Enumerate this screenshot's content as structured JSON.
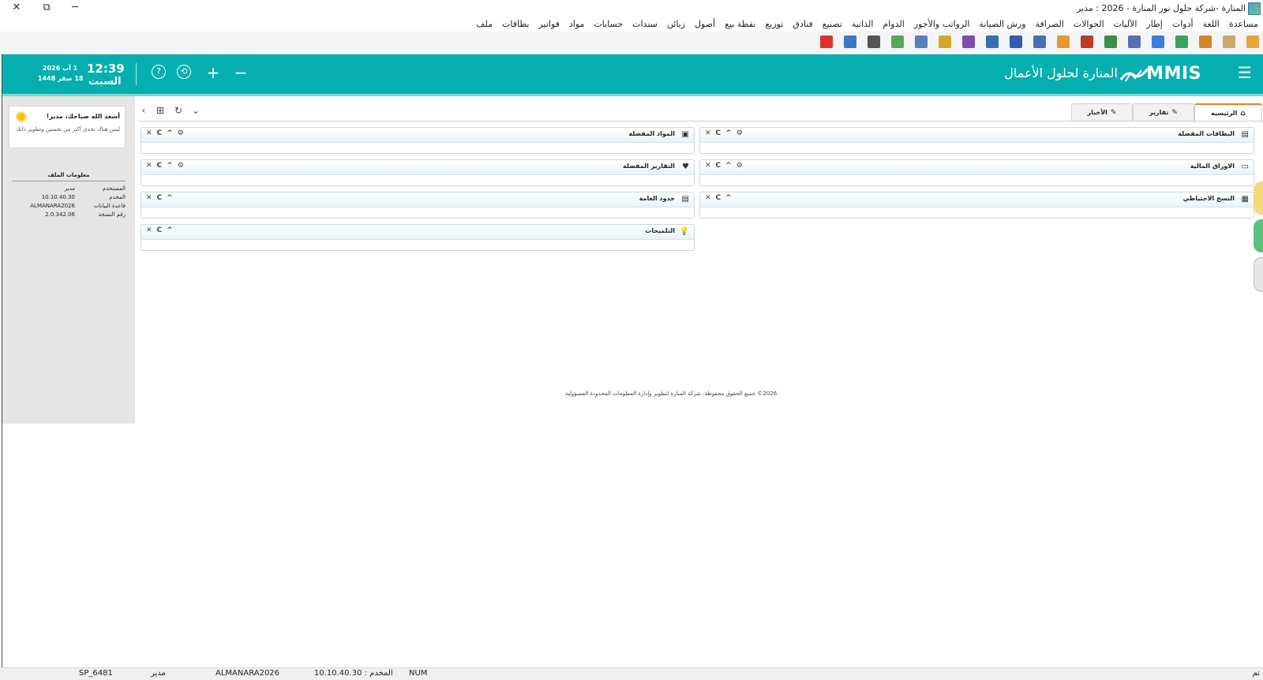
{
  "window": {
    "title": "المنارة -شركة حلول نور المنارة - 2026 : مدير",
    "close_glyph": "✕",
    "restore_glyph": "⧉",
    "minimize_glyph": "─"
  },
  "menu": [
    "ملف",
    "بطاقات",
    "فواتير",
    "مواد",
    "حسابات",
    "سندات",
    "زبائن",
    "أصول",
    "نقطة بيع",
    "توزيع",
    "فنادق",
    "تصنيع",
    "الذاتية",
    "الدوام",
    "الرواتب والأجور",
    "ورش الصيانة",
    "الصرافة",
    "الحوالات",
    "الآليات",
    "إطار",
    "أدوات",
    "اللغة",
    "مساعدة"
  ],
  "toolbar_icons": [
    {
      "name": "folder-icon",
      "color": "#e8a33b"
    },
    {
      "name": "list-card-icon",
      "color": "#c9a86a"
    },
    {
      "name": "users-icon",
      "color": "#d9822b"
    },
    {
      "name": "box-icon",
      "color": "#3aa35c"
    },
    {
      "name": "register-icon",
      "color": "#3b7dd8"
    },
    {
      "name": "document-edit-icon",
      "color": "#5a6fb0"
    },
    {
      "name": "ledger-icon",
      "color": "#3a8f4a"
    },
    {
      "name": "cube-icon",
      "color": "#c0392b"
    },
    {
      "name": "report-icon",
      "color": "#e39b2f"
    },
    {
      "name": "doc-icon",
      "color": "#4a6fb5"
    },
    {
      "name": "book-icon",
      "color": "#2f5fae"
    },
    {
      "name": "balance-icon",
      "color": "#3b6db3"
    },
    {
      "name": "stack-icon",
      "color": "#7b4fb1"
    },
    {
      "name": "money-icon",
      "color": "#d4a62a"
    },
    {
      "name": "person-card-icon",
      "color": "#5b7fb8"
    },
    {
      "name": "palette-icon",
      "color": "#58a65c"
    },
    {
      "name": "barcode-icon",
      "color": "#555555"
    },
    {
      "name": "calculator-icon",
      "color": "#3b78c3"
    },
    {
      "name": "power-icon",
      "color": "#d9342b"
    }
  ],
  "header": {
    "menu_glyph": "☰",
    "logo": "MMIS",
    "brand": "المنارة لحلول الأعمال",
    "help_glyph": "?",
    "sync_glyph": "⟲",
    "add_glyph": "+",
    "minus_glyph": "−",
    "time": "12:39",
    "day": "السبت",
    "gregorian_date": "1 آب 2026",
    "hijri_date": "18 صفر 1448"
  },
  "tabs": [
    {
      "label": "الرئيسيه",
      "icon": "⌂"
    },
    {
      "label": "تقارير",
      "icon": "✎"
    },
    {
      "label": "الأخبار",
      "icon": "✎"
    }
  ],
  "tab_controls": {
    "back": "‹",
    "grid": "⊞",
    "refresh": "↻",
    "expand": "⌄"
  },
  "widget_controls": {
    "close": "✕",
    "refresh": "C",
    "collapse": "^",
    "settings": "⚙"
  },
  "widgets_right": [
    {
      "title": "البطاقات المفضلة",
      "icon": "▤",
      "settings": true
    },
    {
      "title": "الاوراق المالية",
      "icon": "▭",
      "settings": true
    },
    {
      "title": "النسخ الاحتياطي",
      "icon": "▦",
      "settings": false
    }
  ],
  "widgets_left": [
    {
      "title": "المواد المفضلة",
      "icon": "▣",
      "settings": true
    },
    {
      "title": "التقارير المفضلة",
      "icon": "♥",
      "settings": true
    },
    {
      "title": "حدود العامة",
      "icon": "▤",
      "settings": false
    },
    {
      "title": "التلميحات",
      "icon": "💡",
      "settings": false
    }
  ],
  "greeting": {
    "title": "أسعد الله صباحك، مدير!",
    "message": "ليس هناك تحدي أكبر من تحسين وتطوير ذاتك"
  },
  "file_info": {
    "title": "معلومات الملف",
    "rows": [
      {
        "key": "المستخدم",
        "value": "مدير"
      },
      {
        "key": "المخدم",
        "value": "10.10.40.30"
      },
      {
        "key": "قاعدة البيانات",
        "value": "ALMANARA2026"
      },
      {
        "key": "رقم النسخة",
        "value": "2.0.342.06"
      }
    ]
  },
  "copyright": "2026© جميع الحقوق محفوظة، شركة المنارة لتطوير وإدارة المعلومات المحدودة المسؤولية",
  "status": {
    "right_text": "تم",
    "num": "NUM",
    "server": "المخدم : 10.10.40.30",
    "database": "ALMANARA2026",
    "user": "مدير",
    "code": "SP_6481"
  }
}
